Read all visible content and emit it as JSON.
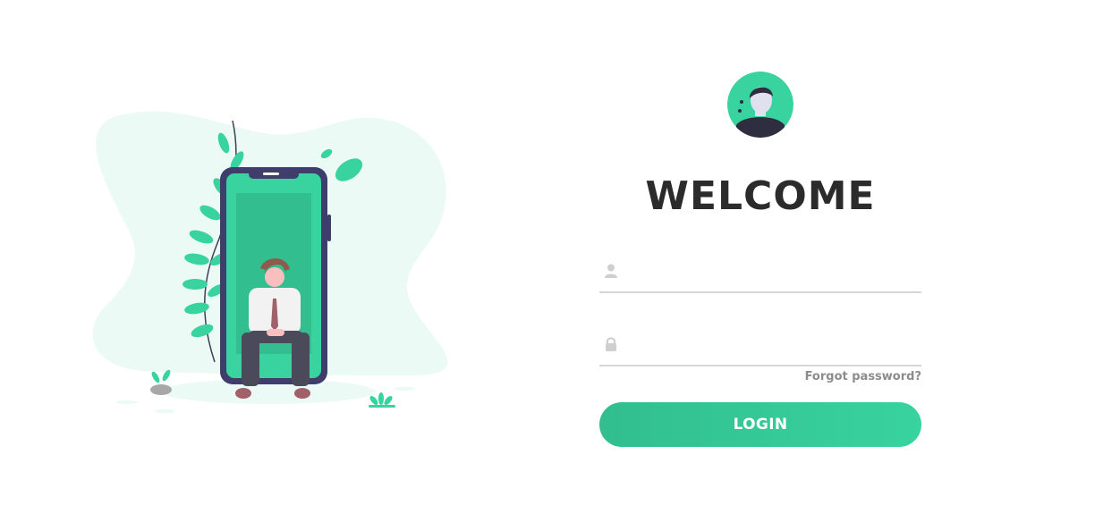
{
  "login": {
    "title": "WELCOME",
    "username": {
      "value": "",
      "placeholder": "",
      "icon": "user-icon"
    },
    "password": {
      "value": "",
      "placeholder": "",
      "icon": "lock-icon"
    },
    "forgot_label": "Forgot password?",
    "login_label": "LOGIN"
  },
  "colors": {
    "accent": "#38d39f",
    "accent_dark": "#32be8f",
    "title": "#2b2b2b",
    "muted": "#8c8c8c",
    "underline": "#d6d6d6",
    "icon": "#cfcfcf",
    "blob": "#ebfaf5",
    "phone_frame": "#3f3d6b"
  }
}
